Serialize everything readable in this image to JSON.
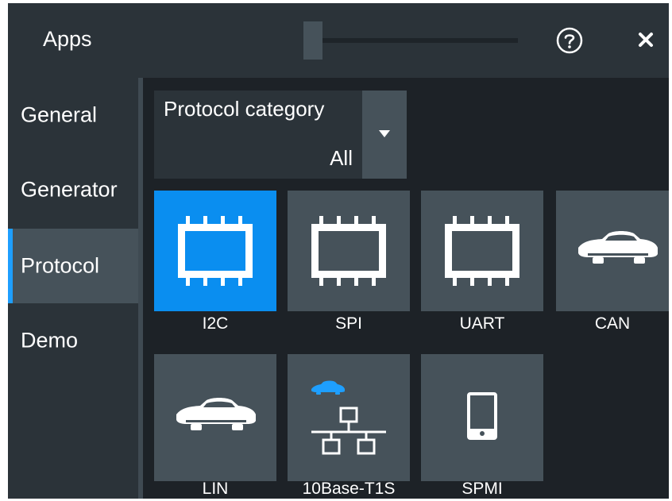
{
  "window": {
    "title": "Apps",
    "help_icon": "help-circle-icon",
    "close_icon": "close-icon"
  },
  "sidebar": {
    "items": [
      {
        "label": "General"
      },
      {
        "label": "Generator"
      },
      {
        "label": "Protocol",
        "selected": true
      },
      {
        "label": "Demo"
      }
    ]
  },
  "filter": {
    "label": "Protocol category",
    "value": "All"
  },
  "apps": [
    {
      "label": "I2C",
      "icon": "chip-icon",
      "selected": true
    },
    {
      "label": "SPI",
      "icon": "chip-icon"
    },
    {
      "label": "UART",
      "icon": "chip-icon"
    },
    {
      "label": "CAN",
      "icon": "car-icon"
    },
    {
      "label": "LIN",
      "icon": "car-icon"
    },
    {
      "label": "10Base-T1S",
      "icon": "network-icon"
    },
    {
      "label": "SPMI",
      "icon": "mobile-phone-icon"
    }
  ],
  "colors": {
    "accent": "#0a8ef0",
    "sidebar_indicator": "#1e9fff",
    "tile": "#46525a",
    "background": "#1d2227"
  }
}
